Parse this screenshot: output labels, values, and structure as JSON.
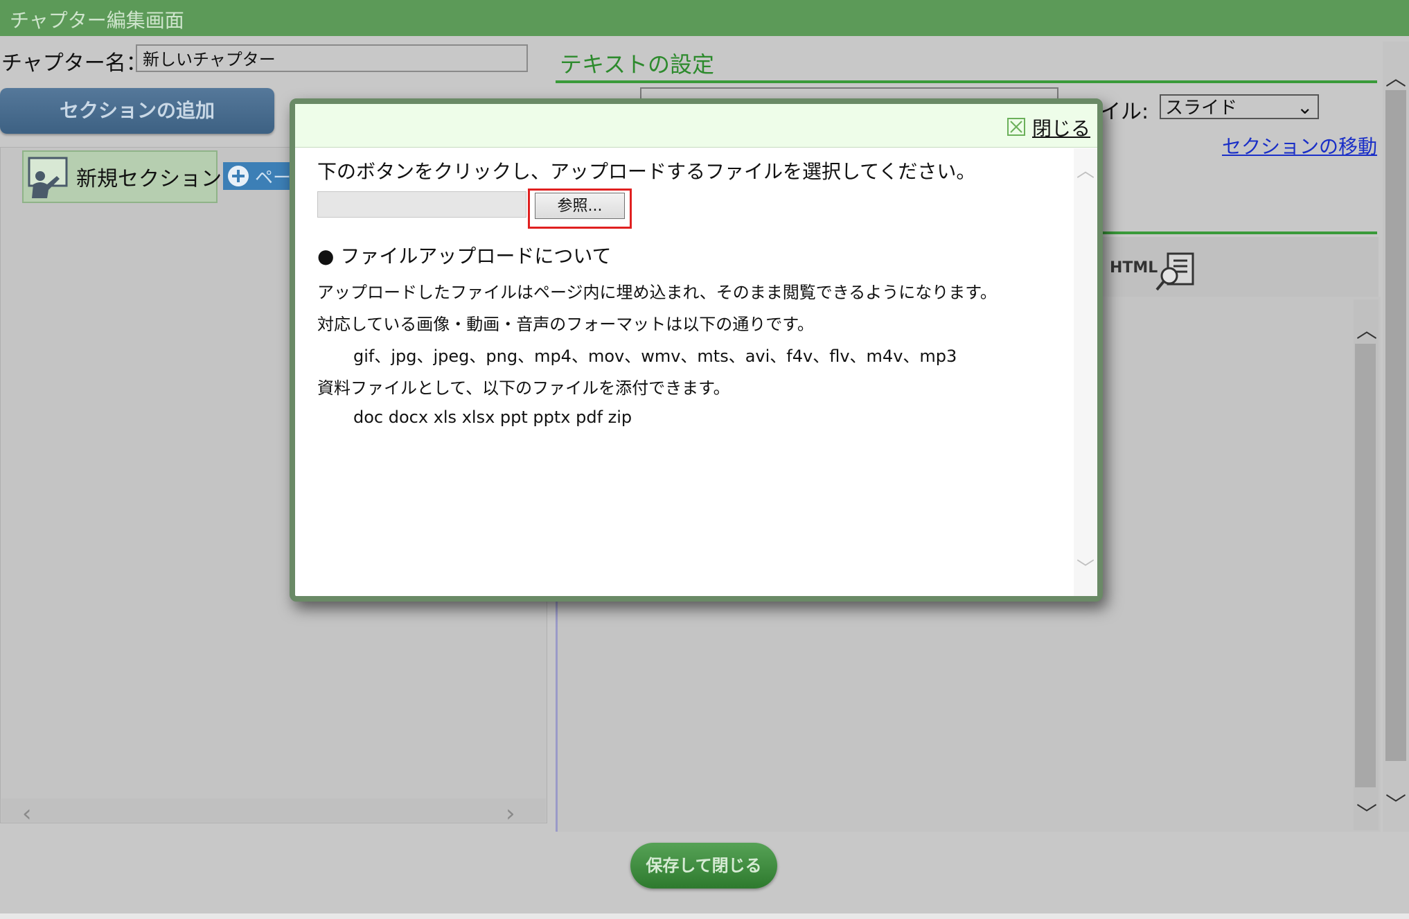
{
  "window": {
    "title": "チャプター編集画面"
  },
  "chapter": {
    "name_label": "チャプター名：",
    "name_value": "新しいチャプター"
  },
  "left_panel": {
    "add_section_label": "セクションの追加",
    "section_label": "新規セクション",
    "add_page_label": "ペー"
  },
  "right_panel": {
    "title": "テキストの設定",
    "style_label": "イル:",
    "style_value": "スライド",
    "move_section_link": "セクションの移動",
    "toolbar_html_label": "HTML"
  },
  "save_button": "保存して閉じる",
  "modal": {
    "close_label": "閉じる",
    "instruction": "下のボタンをクリックし、アップロードするファイルを選択してください。",
    "browse_label": "参照...",
    "about_heading": "● ファイルアップロードについて",
    "line1": "アップロードしたファイルはページ内に埋め込まれ、そのまま閲覧できるようになります。",
    "line2": "対応している画像・動画・音声のフォーマットは以下の通りです。",
    "line3": "gif、jpg、jpeg、png、mp4、mov、wmv、mts、avi、f4v、flv、m4v、mp3",
    "line4": "資料ファイルとして、以下のファイルを添付できます。",
    "line5": "doc docx xls xlsx ppt pptx pdf zip"
  },
  "icons": {
    "section": "teacher-icon",
    "add_page": "plus-circle-icon",
    "preview": "preview-icon",
    "close": "close-x-icon"
  },
  "colors": {
    "title_bar": "#5c9a58",
    "accent_green": "#2d8a2d",
    "link_blue": "#1a2fc7",
    "highlight_red": "#e02020"
  }
}
